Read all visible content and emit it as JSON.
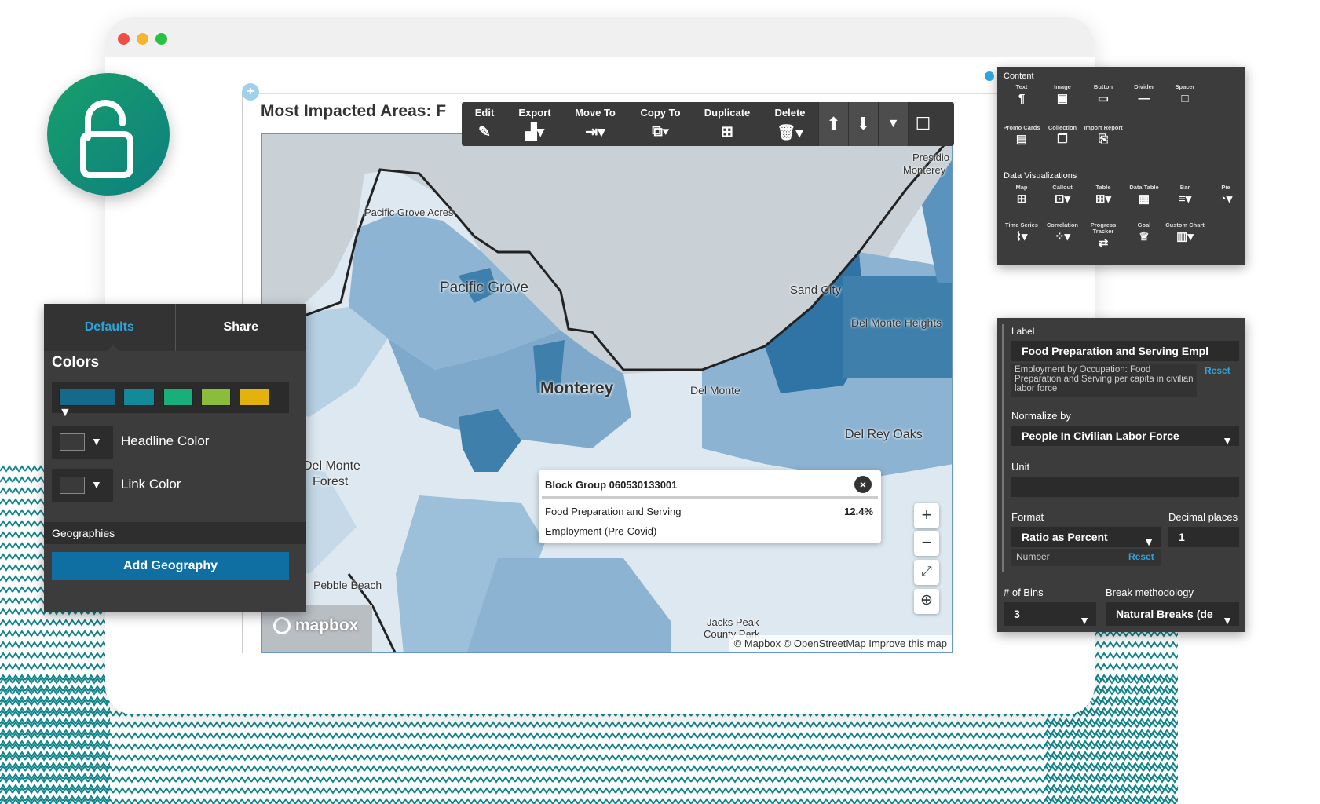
{
  "report": {
    "title": "Most Impacted Areas: F"
  },
  "toolbar": {
    "edit": "Edit",
    "export": "Export",
    "move_to": "Move To",
    "copy_to": "Copy To",
    "duplicate": "Duplicate",
    "delete": "Delete"
  },
  "map": {
    "labels": {
      "pacific_grove_acres": "Pacific Grove Acres",
      "pacific_grove": "Pacific Grove",
      "monterey": "Monterey",
      "del_monte": "Del Monte",
      "sand_city": "Sand City",
      "del_monte_heights": "Del Monte Heights",
      "del_rey_oaks": "Del Rey Oaks",
      "del_monte_forest_1": "Del Monte",
      "del_monte_forest_2": "Forest",
      "pebble_beach": "Pebble Beach",
      "presidio_1": "Presidio",
      "presidio_2": "Monterey",
      "jacks_peak": "Jacks Peak",
      "county_park": "County Park"
    },
    "logo": "mapbox",
    "attribution": "© Mapbox © OpenStreetMap  Improve this map",
    "popup": {
      "title": "Block Group 060530133001",
      "metric_line1": "Food Preparation and Serving",
      "metric_line2": "Employment (Pre-Covid)",
      "value": "12.4%"
    }
  },
  "defaults_panel": {
    "tab_defaults": "Defaults",
    "tab_share": "Share",
    "colors_heading": "Colors",
    "palette": [
      "#156a8c",
      "#128a9a",
      "#17b07a",
      "#8cbc3c",
      "#e3b20c"
    ],
    "headline_color_label": "Headline Color",
    "link_color_label": "Link Color",
    "geographies_heading": "Geographies",
    "add_geography_button": "Add Geography"
  },
  "content_panel": {
    "content_heading": "Content",
    "content_items": [
      {
        "label": "Text",
        "icon": "paragraph-icon",
        "glyph": "¶"
      },
      {
        "label": "Image",
        "icon": "image-icon",
        "glyph": "▣"
      },
      {
        "label": "Button",
        "icon": "button-icon",
        "glyph": "▭"
      },
      {
        "label": "Divider",
        "icon": "divider-icon",
        "glyph": "—"
      },
      {
        "label": "Spacer",
        "icon": "spacer-icon",
        "glyph": "□"
      },
      {
        "label": "Promo Cards",
        "icon": "promo-cards-icon",
        "glyph": "▤"
      },
      {
        "label": "Collection",
        "icon": "collection-icon",
        "glyph": "❐"
      },
      {
        "label": "Import Report",
        "icon": "import-report-icon",
        "glyph": "⎘"
      }
    ],
    "viz_heading": "Data Visualizations",
    "viz_items": [
      {
        "label": "Map",
        "icon": "map-icon",
        "glyph": "⊞"
      },
      {
        "label": "Callout",
        "icon": "callout-icon",
        "glyph": "⊡▾"
      },
      {
        "label": "Table",
        "icon": "table-icon",
        "glyph": "⊞▾"
      },
      {
        "label": "Data Table",
        "icon": "data-table-icon",
        "glyph": "▦"
      },
      {
        "label": "Bar",
        "icon": "bar-icon",
        "glyph": "≡▾"
      },
      {
        "label": "Pie",
        "icon": "pie-icon",
        "glyph": "◔▾"
      },
      {
        "label": "Time Series",
        "icon": "time-series-icon",
        "glyph": "⌇▾"
      },
      {
        "label": "Correlation",
        "icon": "correlation-icon",
        "glyph": "⁘▾"
      },
      {
        "label": "Progress Tracker",
        "icon": "progress-tracker-icon",
        "glyph": "⇄"
      },
      {
        "label": "Goal",
        "icon": "goal-icon",
        "glyph": "♕"
      },
      {
        "label": "Custom Chart",
        "icon": "custom-chart-icon",
        "glyph": "▥▾"
      }
    ]
  },
  "settings_panel": {
    "label_heading": "Label",
    "label_value": "Food Preparation and Serving Empl",
    "label_description": "Employment by Occupation: Food Preparation and Serving per capita in civilian labor force",
    "reset": "Reset",
    "normalize_heading": "Normalize by",
    "normalize_value": "People In Civilian Labor Force",
    "unit_heading": "Unit",
    "unit_value": "",
    "format_heading": "Format",
    "format_value": "Ratio as Percent",
    "format_sub": "Number",
    "format_reset": "Reset",
    "decimal_heading": "Decimal places",
    "decimal_value": "1",
    "bins_heading": "# of Bins",
    "bins_value": "3",
    "break_heading": "Break methodology",
    "break_value": "Natural Breaks (de"
  },
  "colors": {
    "accent_blue": "#2fa4d8",
    "add_button": "#0f6fa3",
    "lock_green": "#13946e",
    "zigzag_teal": "#12858a"
  }
}
